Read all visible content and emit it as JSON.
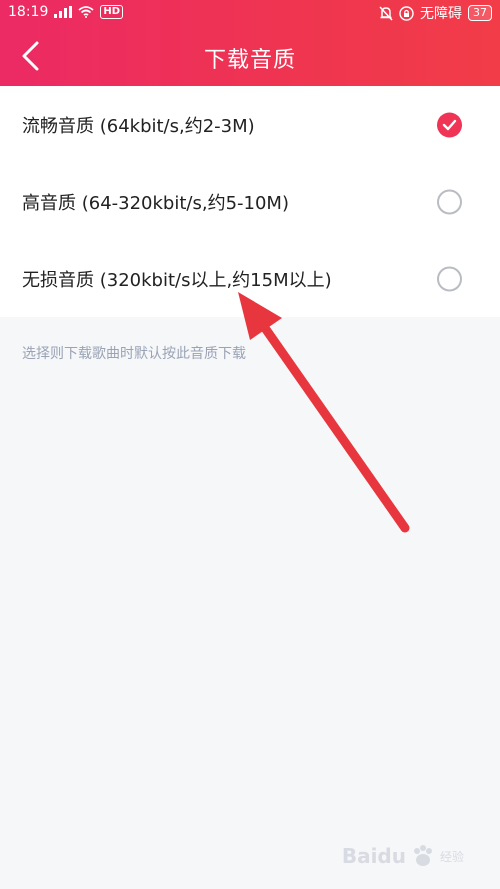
{
  "status_bar": {
    "time": "18:19",
    "network_label": "HD",
    "accessibility_text": "无障碍",
    "battery_level": "37"
  },
  "header": {
    "title": "下载音质"
  },
  "quality_options": [
    {
      "label": "流畅音质 (64kbit/s,约2-3M)",
      "selected": true
    },
    {
      "label": "高音质 (64-320kbit/s,约5-10M)",
      "selected": false
    },
    {
      "label": "无损音质 (320kbit/s以上,约15M以上)",
      "selected": false
    }
  ],
  "hint_text": "选择则下载歌曲时默认按此音质下载",
  "watermark": {
    "text": "Baidu",
    "subtext": "经验"
  },
  "colors": {
    "accent": "#ef3456",
    "header_gradient_start": "#ec2a64",
    "header_gradient_end": "#f23c48",
    "annotation_arrow": "#e8363e"
  }
}
